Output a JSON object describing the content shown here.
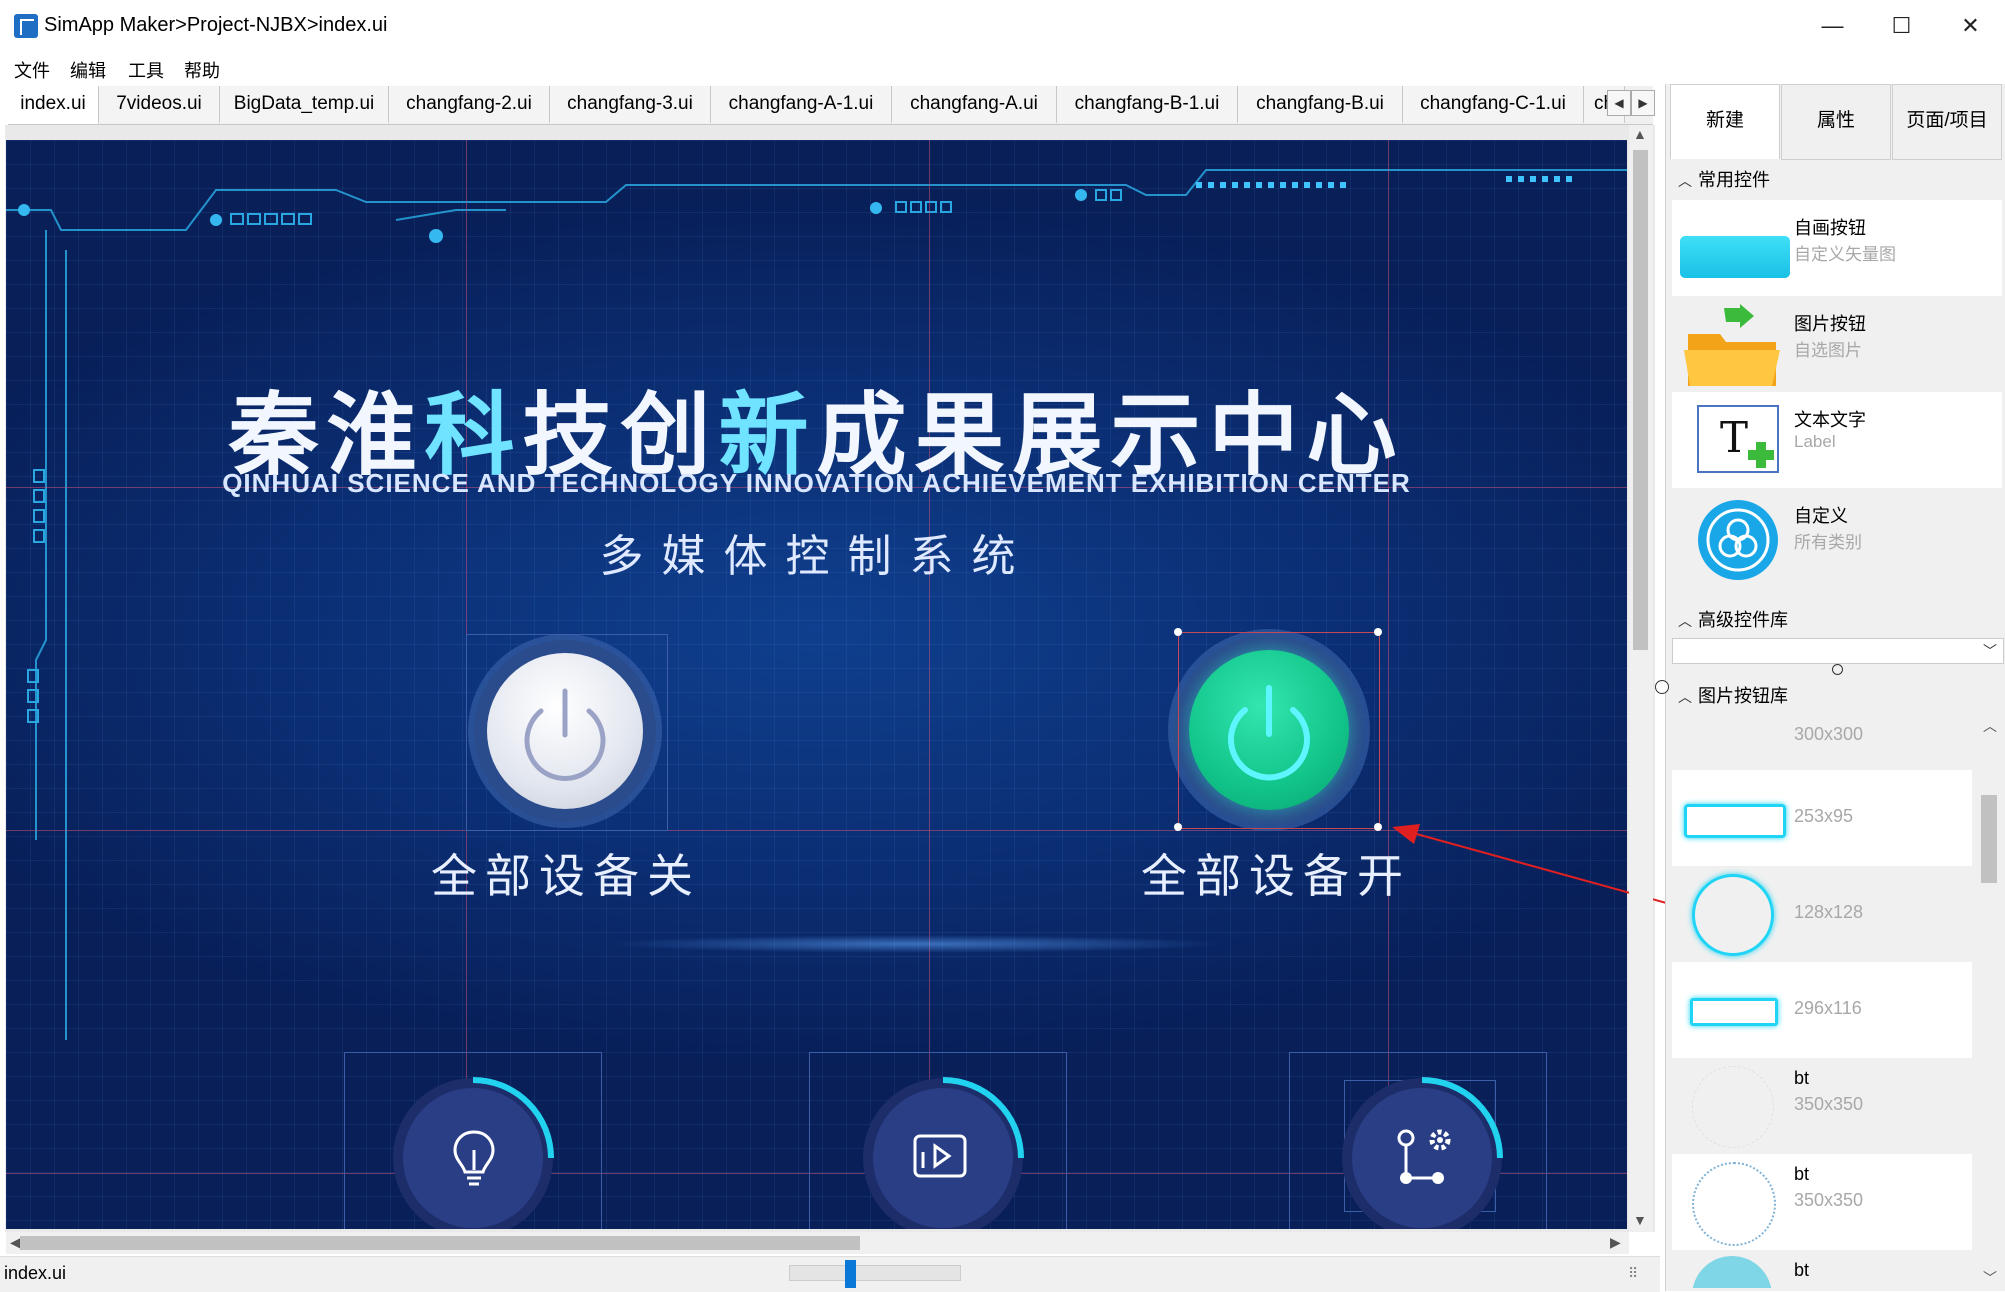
{
  "window": {
    "title": "SimApp Maker>Project-NJBX>index.ui",
    "minimize": "—",
    "maximize": "☐",
    "close": "✕"
  },
  "menu": [
    "文件",
    "编辑",
    "工具",
    "帮助"
  ],
  "tabs": [
    "index.ui",
    "7videos.ui",
    "BigData_temp.ui",
    "changfang-2.ui",
    "changfang-3.ui",
    "changfang-A-1.ui",
    "changfang-A.ui",
    "changfang-B-1.ui",
    "changfang-B.ui",
    "changfang-C-1.ui",
    "ch"
  ],
  "active_tab": "index.ui",
  "canvas": {
    "title_parts": [
      "秦淮",
      "科",
      "技创",
      "新",
      "成果展示中心"
    ],
    "subtitle_en": "QINHUAI SCIENCE AND TECHNOLOGY INNOVATION ACHIEVEMENT EXHIBITION CENTER",
    "subtitle_cn": "多媒体控制系统",
    "btn_off_label": "全部设备关",
    "btn_on_label": "全部设备开"
  },
  "status": {
    "filename": "index.ui"
  },
  "panel": {
    "tabs": [
      "新建",
      "属性",
      "页面/项目"
    ],
    "sections": {
      "common": "常用控件",
      "advanced": "高级控件库",
      "image_lib": "图片按钮库"
    },
    "common_widgets": [
      {
        "name": "自画按钮",
        "desc": "自定义矢量图",
        "icon": "flat-button-icon"
      },
      {
        "name": "图片按钮",
        "desc": "自选图片",
        "icon": "folder-image-icon"
      },
      {
        "name": "文本文字",
        "desc": "Label",
        "icon": "text-label-icon"
      },
      {
        "name": "自定义",
        "desc": "所有类别",
        "icon": "custom-widget-icon"
      }
    ],
    "image_buttons": [
      {
        "name": "",
        "size": "300x300"
      },
      {
        "name": "",
        "size": "253x95"
      },
      {
        "name": "",
        "size": "128x128"
      },
      {
        "name": "",
        "size": "296x116"
      },
      {
        "name": "bt",
        "size": "350x350"
      },
      {
        "name": "bt",
        "size": "350x350"
      },
      {
        "name": "bt",
        "size": ""
      }
    ]
  },
  "colors": {
    "canvas_bg": "#0b2e73",
    "accent_cyan": "#22d3f0",
    "power_on": "#11c489",
    "selection": "#c44858",
    "annotation_arrow": "#e02020"
  }
}
